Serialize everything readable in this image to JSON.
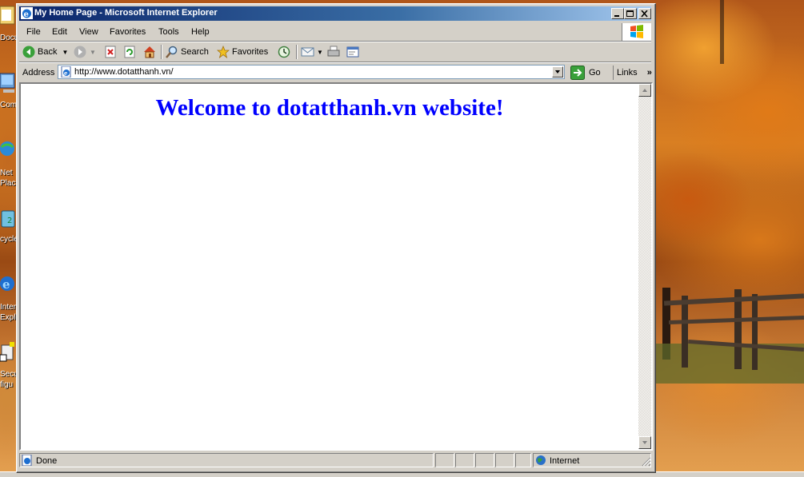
{
  "window": {
    "title": "My Home Page - Microsoft Internet Explorer"
  },
  "menu": {
    "items": [
      {
        "label": "File"
      },
      {
        "label": "Edit"
      },
      {
        "label": "View"
      },
      {
        "label": "Favorites"
      },
      {
        "label": "Tools"
      },
      {
        "label": "Help"
      }
    ]
  },
  "toolbar": {
    "back_label": "Back",
    "search_label": "Search",
    "favorites_label": "Favorites"
  },
  "address": {
    "label": "Address",
    "url": "http://www.dotatthanh.vn/",
    "go_label": "Go",
    "links_label": "Links"
  },
  "page": {
    "heading": "Welcome to dotatthanh.vn website!"
  },
  "status": {
    "text": "Done",
    "zone": "Internet"
  },
  "desktop": {
    "icons": [
      {
        "label": "Docu",
        "icon": "my-documents-icon"
      },
      {
        "label": "Com",
        "icon": "my-computer-icon"
      },
      {
        "label": "Net Place",
        "icon": "network-places-icon"
      },
      {
        "label": "cycle",
        "icon": "recycle-bin-icon"
      },
      {
        "label": "Intern Explo",
        "icon": "internet-explorer-icon"
      },
      {
        "label": "Secu figu",
        "icon": "security-config-icon"
      }
    ]
  },
  "colors": {
    "title_active": "#0a246a",
    "heading": "#0000ff",
    "chrome": "#d4d0c8"
  }
}
